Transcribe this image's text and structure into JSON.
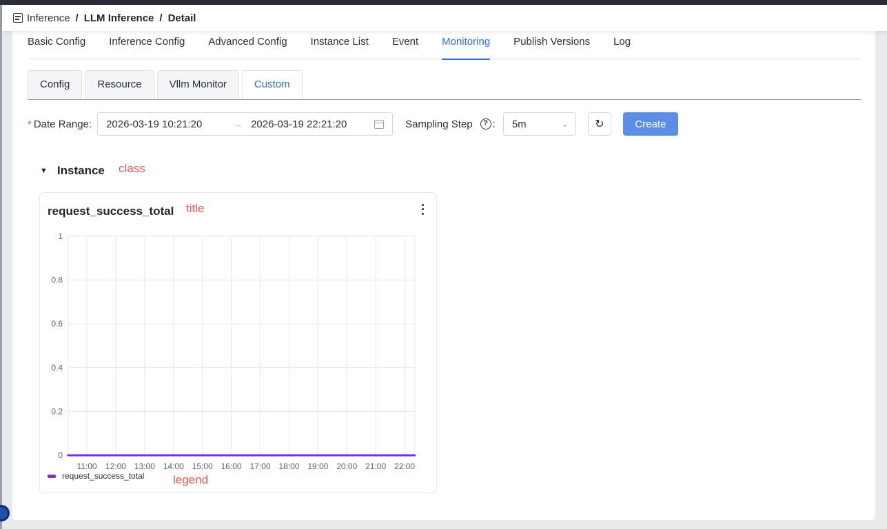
{
  "breadcrumb": {
    "items": [
      "Inference",
      "LLM Inference",
      "Detail"
    ],
    "separator": "/"
  },
  "main_tabs": [
    {
      "label": "Basic Config",
      "active": false
    },
    {
      "label": "Inference Config",
      "active": false
    },
    {
      "label": "Advanced Config",
      "active": false
    },
    {
      "label": "Instance List",
      "active": false
    },
    {
      "label": "Event",
      "active": false
    },
    {
      "label": "Monitoring",
      "active": true
    },
    {
      "label": "Publish Versions",
      "active": false
    },
    {
      "label": "Log",
      "active": false
    }
  ],
  "sub_tabs": [
    {
      "label": "Config",
      "active": false
    },
    {
      "label": "Resource",
      "active": false
    },
    {
      "label": "Vllm Monitor",
      "active": false
    },
    {
      "label": "Custom",
      "active": true
    }
  ],
  "filters": {
    "required_mark": "*",
    "date_range_label": "Date Range",
    "date_range_colon": ":",
    "date_start": "2026-03-19 10:21:20",
    "date_arrow": "→",
    "date_end": "2026-03-19 22:21:20",
    "sampling_step_label": "Sampling Step",
    "help_glyph": "?",
    "sampling_colon": ":",
    "sampling_value": "5m",
    "refresh_glyph": "↻",
    "create_label": "Create"
  },
  "section": {
    "title": "Instance",
    "annotation": "class"
  },
  "card": {
    "title": "request_success_total",
    "title_annotation": "title",
    "legend_annotation": "legend"
  },
  "colors": {
    "accent": "#2f6fd6",
    "create_button": "#5c8ee6",
    "annotation": "#e05a4f",
    "series": "#7b2fd8",
    "grid": "#e3e7ec"
  },
  "chart_data": {
    "type": "line",
    "title": "request_success_total",
    "xlabel": "",
    "ylabel": "",
    "x_tick_labels": [
      "11:00",
      "12:00",
      "13:00",
      "14:00",
      "15:00",
      "16:00",
      "17:00",
      "18:00",
      "19:00",
      "20:00",
      "21:00",
      "22:00"
    ],
    "y_tick_labels": [
      "0",
      "0.2",
      "0.4",
      "0.6",
      "0.8",
      "1"
    ],
    "ylim": [
      0,
      1
    ],
    "xlim": [
      "10:21:20",
      "22:21:20"
    ],
    "grid": true,
    "legend_position": "bottom-left",
    "series": [
      {
        "name": "request_success_total",
        "x": [
          "10:21",
          "11:00",
          "12:00",
          "13:00",
          "14:00",
          "15:00",
          "16:00",
          "17:00",
          "18:00",
          "19:00",
          "20:00",
          "21:00",
          "22:00",
          "22:21"
        ],
        "values": [
          0,
          0,
          0,
          0,
          0,
          0,
          0,
          0,
          0,
          0,
          0,
          0,
          0,
          0
        ]
      }
    ]
  }
}
